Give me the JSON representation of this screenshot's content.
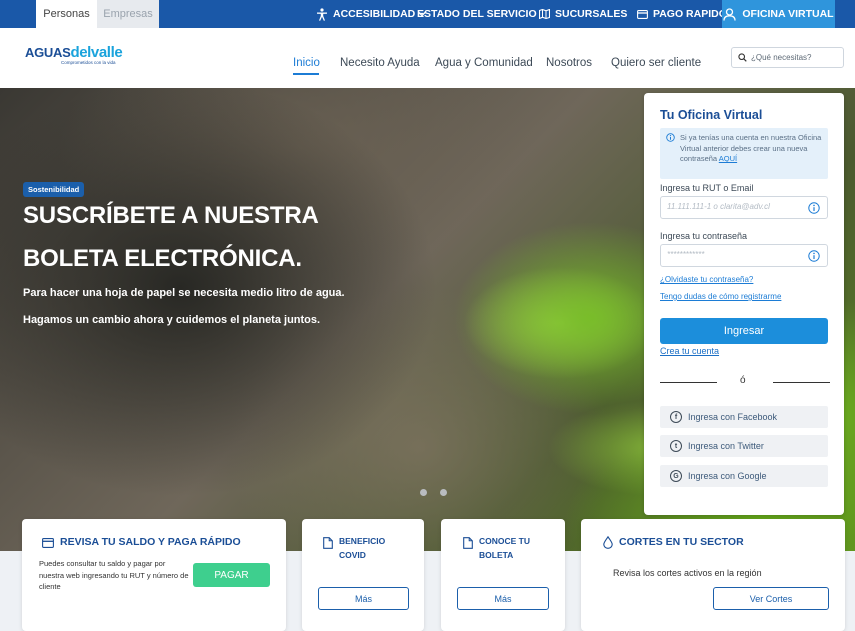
{
  "topbar": {
    "segments": [
      "Personas",
      "Empresas"
    ],
    "links": {
      "accesibilidad": "ACCESIBILIDAD",
      "estado": "ESTADO DEL SERVICIO",
      "sucursales": "SUCURSALES",
      "pago": "PAGO RAPIDO",
      "oficina": "OFICINA VIRTUAL"
    }
  },
  "header": {
    "logo": {
      "part1": "AGUAS",
      "part2": "delvalle",
      "tagline": "Comprometidos con la vida"
    },
    "nav": [
      "Inicio",
      "Necesito Ayuda",
      "Agua y Comunidad",
      "Nosotros",
      "Quiero ser cliente"
    ],
    "search_placeholder": "¿Qué necesitas?"
  },
  "hero": {
    "badge": "Sostenibilidad",
    "title_line1": "SUSCRÍBETE A NUESTRA",
    "title_line2": "BOLETA ELECTRÓNICA.",
    "text1": "Para hacer una hoja de papel se necesita medio litro de agua.",
    "text2": "Hagamos un cambio ahora y cuidemos el planeta juntos."
  },
  "login": {
    "title": "Tu Oficina Virtual",
    "info_text": "Si ya tenías una cuenta en nuestra Oficina Virtual anterior debes crear una nueva contraseña",
    "info_link": "AQUÍ",
    "rut_label": "Ingresa tu RUT o Email",
    "rut_placeholder": "11.111.111-1 o clarita@adv.cl",
    "pass_label": "Ingresa tu contraseña",
    "pass_placeholder": "************",
    "forgot": "¿Olvidaste tu contraseña?",
    "register_help": "Tengo dudas de cómo registrarme",
    "submit": "Ingresar",
    "create": "Crea tu cuenta",
    "or": "ó",
    "social": [
      "Ingresa con Facebook",
      "Ingresa con Twitter",
      "Ingresa con Google"
    ]
  },
  "cards": {
    "saldo": {
      "title": "REVISA TU SALDO Y PAGA RÁPIDO",
      "text": "Puedes consultar tu saldo y pagar por nuestra web ingresando tu RUT y número de cliente",
      "button": "PAGAR"
    },
    "covid": {
      "title": "BENEFICIO COVID",
      "button": "Más"
    },
    "boleta": {
      "title": "CONOCE TU BOLETA",
      "button": "Más"
    },
    "cortes": {
      "title": "CORTES EN TU SECTOR",
      "text": "Revisa los cortes activos en la región",
      "button": "Ver Cortes"
    }
  },
  "colors": {
    "brand_blue": "#1a58a8",
    "accent_blue": "#2f95dc",
    "pay_green": "#3ecf8e"
  }
}
